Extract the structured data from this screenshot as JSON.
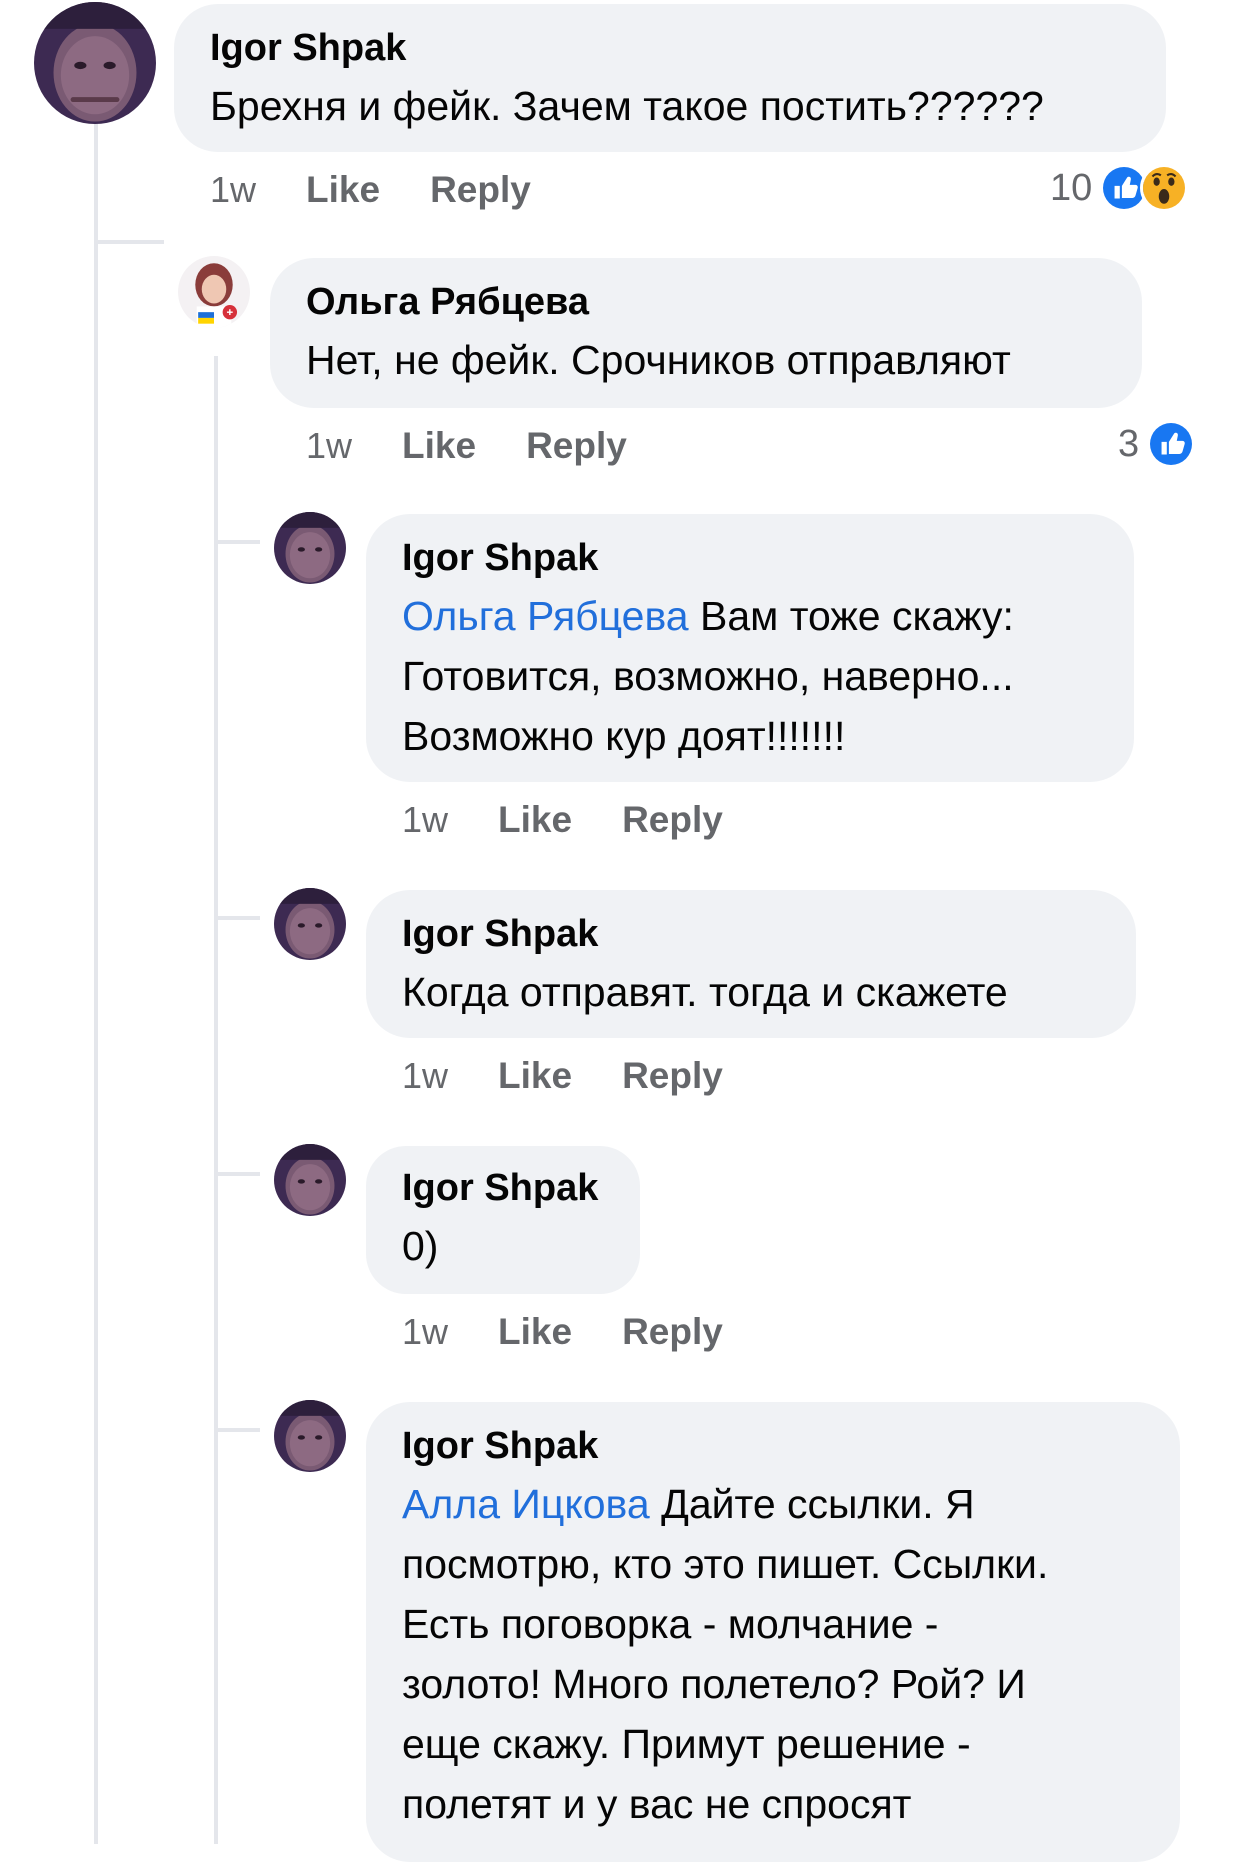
{
  "comments": [
    {
      "author": "Igor Shpak",
      "text": "Брехня и фейк. Зачем такое постить??????",
      "time": "1w",
      "like_label": "Like",
      "reply_label": "Reply",
      "reaction_count": "10",
      "reactions": [
        "like-icon",
        "wow-icon"
      ]
    }
  ],
  "replies": [
    {
      "author": "Ольга Рябцева",
      "text": "Нет, не фейк. Срочников отправляют",
      "time": "1w",
      "like_label": "Like",
      "reply_label": "Reply",
      "reaction_count": "3",
      "reactions": [
        "like-icon"
      ]
    },
    {
      "author": "Igor Shpak",
      "mention": "Ольга Рябцева",
      "text_line1": " Вам тоже скажу:",
      "text_line2": "Готовится, возможно, наверно...",
      "text_line3": "Возможно кур доят!!!!!!!",
      "time": "1w",
      "like_label": "Like",
      "reply_label": "Reply"
    },
    {
      "author": "Igor Shpak",
      "text": "Когда отправят. тогда и скажете",
      "time": "1w",
      "like_label": "Like",
      "reply_label": "Reply"
    },
    {
      "author": "Igor Shpak",
      "text": "0)",
      "time": "1w",
      "like_label": "Like",
      "reply_label": "Reply"
    },
    {
      "author": "Igor Shpak",
      "mention": "Алла Ицкова",
      "text_line1": " Дайте ссылки. Я",
      "text_line2": "посмотрю, кто это пишет. Ссылки.",
      "text_line3": "Есть поговорка - молчание -",
      "text_line4": "золото! Много полетело? Рой? И",
      "text_line5": "еще скажу. Примут решение -",
      "text_line6": "полетят и у вас не спросят"
    }
  ],
  "colors": {
    "bubble": "#f0f2f5",
    "mention": "#216fdb",
    "meta": "#65676b",
    "like_blue": "#1877f2",
    "wow_yellow": "#f7b125"
  }
}
